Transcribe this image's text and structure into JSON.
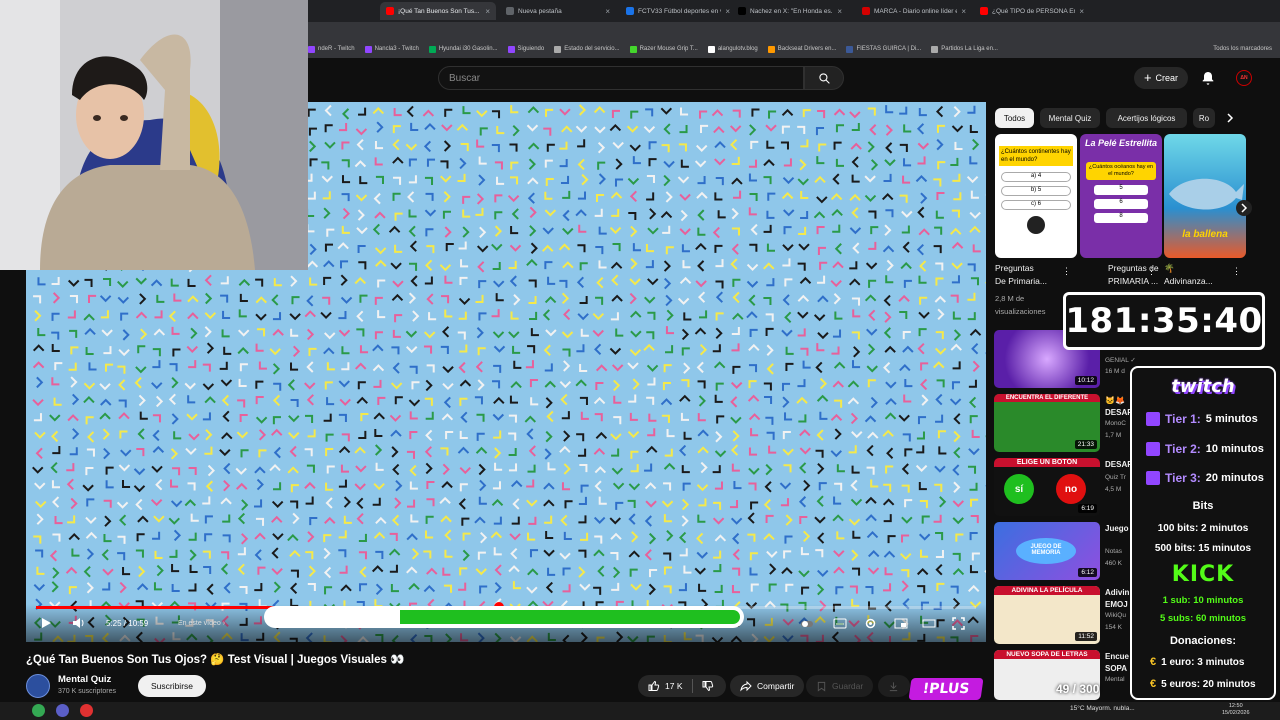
{
  "browser": {
    "tabs": [
      {
        "label": "¡Qué Tan Buenos Son Tus...",
        "color": "#ff0000",
        "active": true
      },
      {
        "label": "Nueva pestaña",
        "color": "#5f6368",
        "active": false
      },
      {
        "label": "FCTV33 Fútbol deportes en vi...",
        "color": "#1a73e8",
        "active": false
      },
      {
        "label": "Nachez en X: \"En Honda es...",
        "color": "#000000",
        "active": false
      },
      {
        "label": "MARCA - Diario online líder en...",
        "color": "#d40000",
        "active": false
      },
      {
        "label": "¿Qué TIPO de PERSONA Eres?",
        "color": "#ff0000",
        "active": false
      }
    ],
    "bookmarks": [
      {
        "label": "ndeR - Twitch",
        "color": "#9146ff"
      },
      {
        "label": "Nancla3 - Twitch",
        "color": "#9146ff"
      },
      {
        "label": "Hyundai i30 Gasolin...",
        "color": "#0a5"
      },
      {
        "label": "Siguiendo",
        "color": "#9146ff"
      },
      {
        "label": "Estado del servicio...",
        "color": "#aaa"
      },
      {
        "label": "Razer Mouse Grip T...",
        "color": "#44d62c"
      },
      {
        "label": "alangulotv.blog",
        "color": "#fff"
      },
      {
        "label": "Backseat Drivers en...",
        "color": "#f90"
      },
      {
        "label": "FIESTAS GUIRCA | Di...",
        "color": "#3b5998"
      },
      {
        "label": "Partidos La Liga en...",
        "color": "#aaa"
      }
    ],
    "all_bookmarks": "Todos los marcadores"
  },
  "header": {
    "search_placeholder": "Buscar",
    "create_label": "Crear",
    "avatar_text": "ΔN"
  },
  "player": {
    "time_current": "5:25",
    "time_total": "10:59",
    "time_display": "5:25 / 10:59",
    "chapter": "En este vídeo ›",
    "progress_fraction": 0.493,
    "overlay_progress_fraction": 0.72
  },
  "video": {
    "title": "¿Qué Tan Buenos Son Tus Ojos? 🤔 Test Visual | Juegos Visuales 👀",
    "channel_name": "Mental Quiz",
    "subscribers": "370 K suscriptores",
    "subscribe_label": "Suscribirse",
    "likes": "17 K",
    "share_label": "Compartir",
    "save_label": "Guardar"
  },
  "sidebar": {
    "chips": [
      {
        "label": "Todos",
        "selected": true
      },
      {
        "label": "Mental Quiz",
        "selected": false
      },
      {
        "label": "Acertijos lógicos",
        "selected": false
      },
      {
        "label": "Ro",
        "selected": false
      }
    ],
    "shorts": [
      {
        "title": "Preguntas",
        "title2": "De Primaria...",
        "meta": "2,8 M de",
        "meta2": "visualizaciones",
        "thumb_text": "¿Cuántos continentes hay en el mundo?",
        "opt1": "a) 4",
        "opt2": "b) 5",
        "opt3": "c) 6"
      },
      {
        "title": "Preguntas de",
        "title2": "PRIMARIA ...",
        "thumb_text": "La Pelé Estrellita",
        "thumb_q": "¿Cuántos océanos hay en el mundo?",
        "opt1": "5",
        "opt2": "6",
        "opt3": "8"
      },
      {
        "title": "🌴",
        "title2": "Adivinanza...",
        "thumb_text": "la ballena"
      }
    ],
    "videos": [
      {
        "title": "",
        "meta": "GENIAL ✓",
        "meta2": "16 M d",
        "duration": "10:12",
        "thumb_text": ""
      },
      {
        "title": "🐱🦊",
        "title2": "DESAF",
        "meta": "MonoC",
        "meta2": "1,7 M",
        "duration": "21:33",
        "thumb_text": "ENCUENTRA EL DIFERENTE"
      },
      {
        "title": "DESAF",
        "meta": "Quiz Tr",
        "meta2": "4,5 M",
        "duration": "6:19",
        "thumb_text": "ELIGE UN BOTÓN",
        "yes": "sí",
        "no": "no"
      },
      {
        "title": "Juego",
        "meta": "Notas",
        "meta2": "460 K",
        "duration": "6:12",
        "thumb_text": "JUEGO DE MEMORIA"
      },
      {
        "title": "Adivin",
        "title2": "EMOJ",
        "meta": "WikiQu",
        "meta2": "154 K",
        "duration": "11:52",
        "thumb_text": "ADIVINA LA PELÍCULA"
      },
      {
        "title": "Encue",
        "title2": "SOPA",
        "meta": "Mental",
        "duration": "",
        "thumb_text": "NUEVO SOPA DE LETRAS"
      }
    ]
  },
  "stream": {
    "timer": "181:35:40",
    "twitch_logo": "twitch",
    "tiers": [
      {
        "label": "Tier 1:",
        "value": "5 minutos"
      },
      {
        "label": "Tier 2:",
        "value": "10 minutos"
      },
      {
        "label": "Tier 3:",
        "value": "20 minutos"
      }
    ],
    "bits_heading": "Bits",
    "bits": [
      "100 bits: 2 minutos",
      "500 bits: 15 minutos"
    ],
    "kick_logo": "KICK",
    "kick": [
      "1 sub: 10 minutos",
      "5 subs: 60 minutos"
    ],
    "donations_heading": "Donaciones:",
    "donations": [
      "1 euro: 3 minutos",
      "5 euros: 20 minutos"
    ],
    "plus_badge": "!PLUS",
    "counter": "49 / 300"
  },
  "taskbar": {
    "weather": "15°C  Mayorm. nubla...",
    "time": "12:50",
    "date": "15/02/2026"
  },
  "colors": {
    "accent": "#ff0000",
    "twitch": "#9146ff",
    "kick": "#53fc18",
    "video_bg": "#8fc7ea"
  }
}
